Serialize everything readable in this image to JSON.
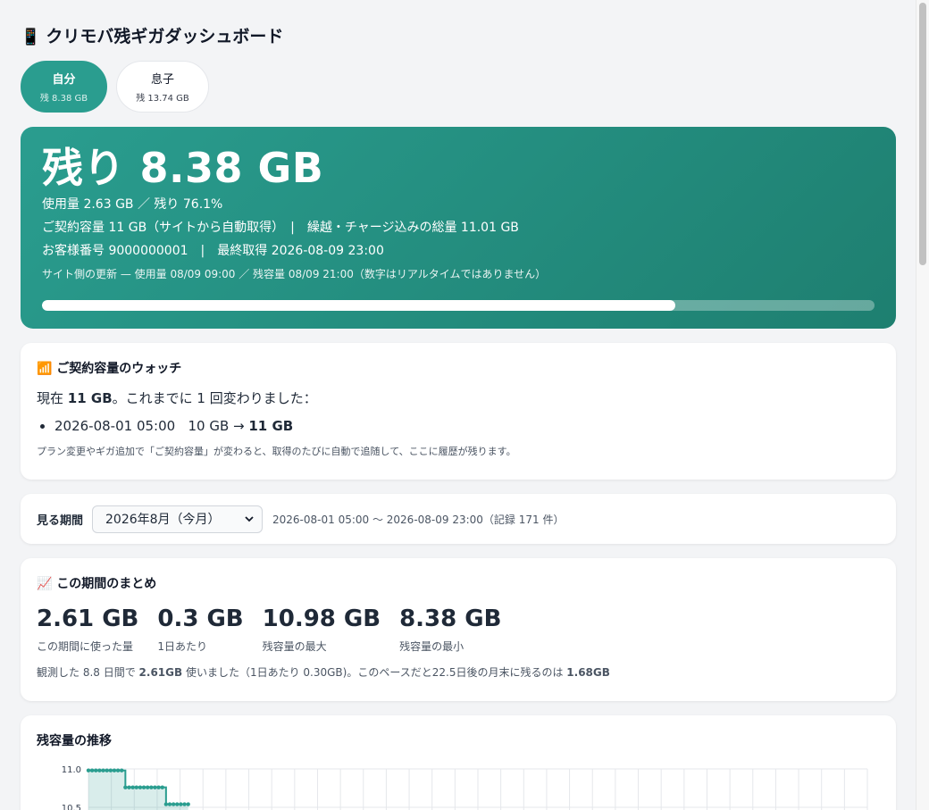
{
  "app": {
    "icon": "📱",
    "title": "クリモバ残ギガダッシュボード"
  },
  "tabs": [
    {
      "name": "自分",
      "sub": "残 8.38 GB",
      "active": true
    },
    {
      "name": "息子",
      "sub": "残 13.74 GB",
      "active": false
    }
  ],
  "hero": {
    "remaining": "残り 8.38 GB",
    "usage_line": "使用量 2.63 GB ／ 残り 76.1%",
    "contract_line": "ご契約容量 11 GB（サイトから自動取得）　|　繰越・チャージ込みの総量 11.01 GB",
    "customer_line": "お客様番号 9000000001　|　最終取得 2026-08-09 23:00",
    "update_line": "サイト側の更新 — 使用量 08/09 09:00 ／ 残容量 08/09 21:00（数字はリアルタイムではありません）",
    "progress_percent": 76.1
  },
  "watch": {
    "icon": "📶",
    "title": "ご契約容量のウォッチ",
    "now_prefix": "現在 ",
    "now_value": "11 GB",
    "now_suffix": "。これまでに 1 回変わりました：",
    "history": [
      {
        "date": "2026-08-01 05:00",
        "from": "10 GB",
        "arrow": " → ",
        "to": "11 GB"
      }
    ],
    "note": "プラン変更やギガ追加で「ご契約容量」が変わると、取得のたびに自動で追随して、ここに履歴が残ります。"
  },
  "period": {
    "label": "見る期間",
    "selected": "2026年8月（今月）",
    "range": "2026-08-01 05:00 〜 2026-08-09 23:00（記録 171 件）"
  },
  "summary": {
    "icon": "📈",
    "title": "この期間のまとめ",
    "stats": [
      {
        "value": "2.61 GB",
        "caption": "この期間に使った量"
      },
      {
        "value": "0.3 GB",
        "caption": "1日あたり"
      },
      {
        "value": "10.98 GB",
        "caption": "残容量の最大"
      },
      {
        "value": "8.38 GB",
        "caption": "残容量の最小"
      }
    ],
    "desc_a": "観測した 8.8 日間で ",
    "desc_b": "2.61GB",
    "desc_c": " 使いました（1日あたり 0.30GB)。このペースだと22.5日後の月末に残るのは ",
    "desc_d": "1.68GB"
  },
  "chart_section": {
    "title": "残容量の推移"
  },
  "chart_data": {
    "type": "area",
    "title": "残容量の推移",
    "y_ticks": [
      "11.0",
      "10.5"
    ],
    "ylim": [
      10.5,
      11.0
    ],
    "grid": true,
    "x_columns": 34,
    "series": [
      {
        "points_index": [
          0,
          1,
          2,
          3,
          4,
          5,
          6,
          7,
          8,
          9,
          10,
          11,
          12,
          13,
          14,
          15,
          16,
          17,
          18,
          19,
          20,
          21,
          22,
          23,
          24,
          25,
          26,
          27
        ],
        "values": [
          10.98,
          10.98,
          10.98,
          10.98,
          10.98,
          10.98,
          10.98,
          10.98,
          10.98,
          10.98,
          10.76,
          10.76,
          10.76,
          10.76,
          10.76,
          10.76,
          10.76,
          10.76,
          10.76,
          10.76,
          10.76,
          10.54,
          10.54,
          10.54,
          10.54,
          10.54,
          10.54,
          10.54
        ]
      }
    ],
    "color": "#2a9d8f"
  },
  "colors": {
    "accent": "#2a9d8f",
    "accent_dark": "#1e7f70"
  }
}
